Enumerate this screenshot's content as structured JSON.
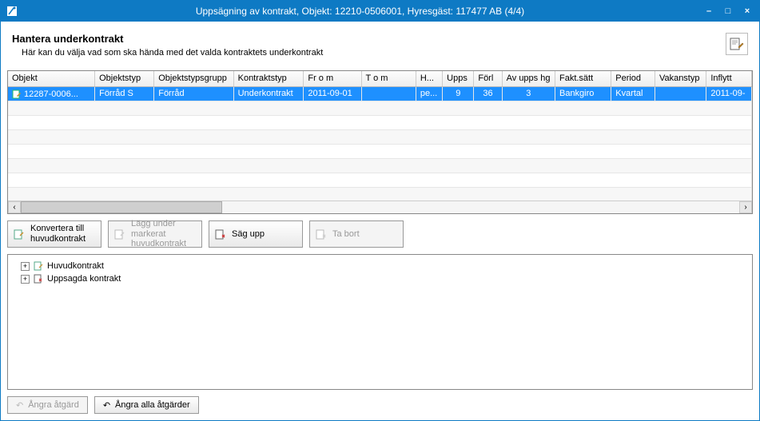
{
  "titlebar": {
    "title": "Uppsägning av kontrakt, Objekt: 12210-0506001, Hyresgäst: 117477 AB (4/4)"
  },
  "header": {
    "title": "Hantera underkontrakt",
    "subtitle": "Här kan du välja vad som ska hända med det valda kontraktets underkontrakt"
  },
  "grid": {
    "columns": [
      "Objekt",
      "Objektstyp",
      "Objektstypsgrupp",
      "Kontraktstyp",
      "Fr o m",
      "T o m",
      "H...",
      "Upps",
      "Förl",
      "Av upps hg",
      "Fakt.sätt",
      "Period",
      "Vakanstyp",
      "Inflytt"
    ],
    "rows": [
      {
        "selected": true,
        "cells": [
          "12287-0006...",
          "Förråd S",
          "Förråd",
          "Underkontrakt",
          "2011-09-01",
          "",
          "pe...",
          "9",
          "36",
          "3",
          "Bankgiro",
          "Kvartal",
          "",
          "2011-09-"
        ]
      }
    ]
  },
  "buttons": {
    "convert": "Konvertera till huvudkontrakt",
    "place_under": "Lägg under markerat huvudkontrakt",
    "terminate": "Säg upp",
    "remove": "Ta bort"
  },
  "tree": {
    "items": [
      {
        "label": "Huvudkontrakt"
      },
      {
        "label": "Uppsagda kontrakt"
      }
    ]
  },
  "footer": {
    "undo": "Ångra åtgärd",
    "undo_all": "Ångra alla åtgärder"
  }
}
